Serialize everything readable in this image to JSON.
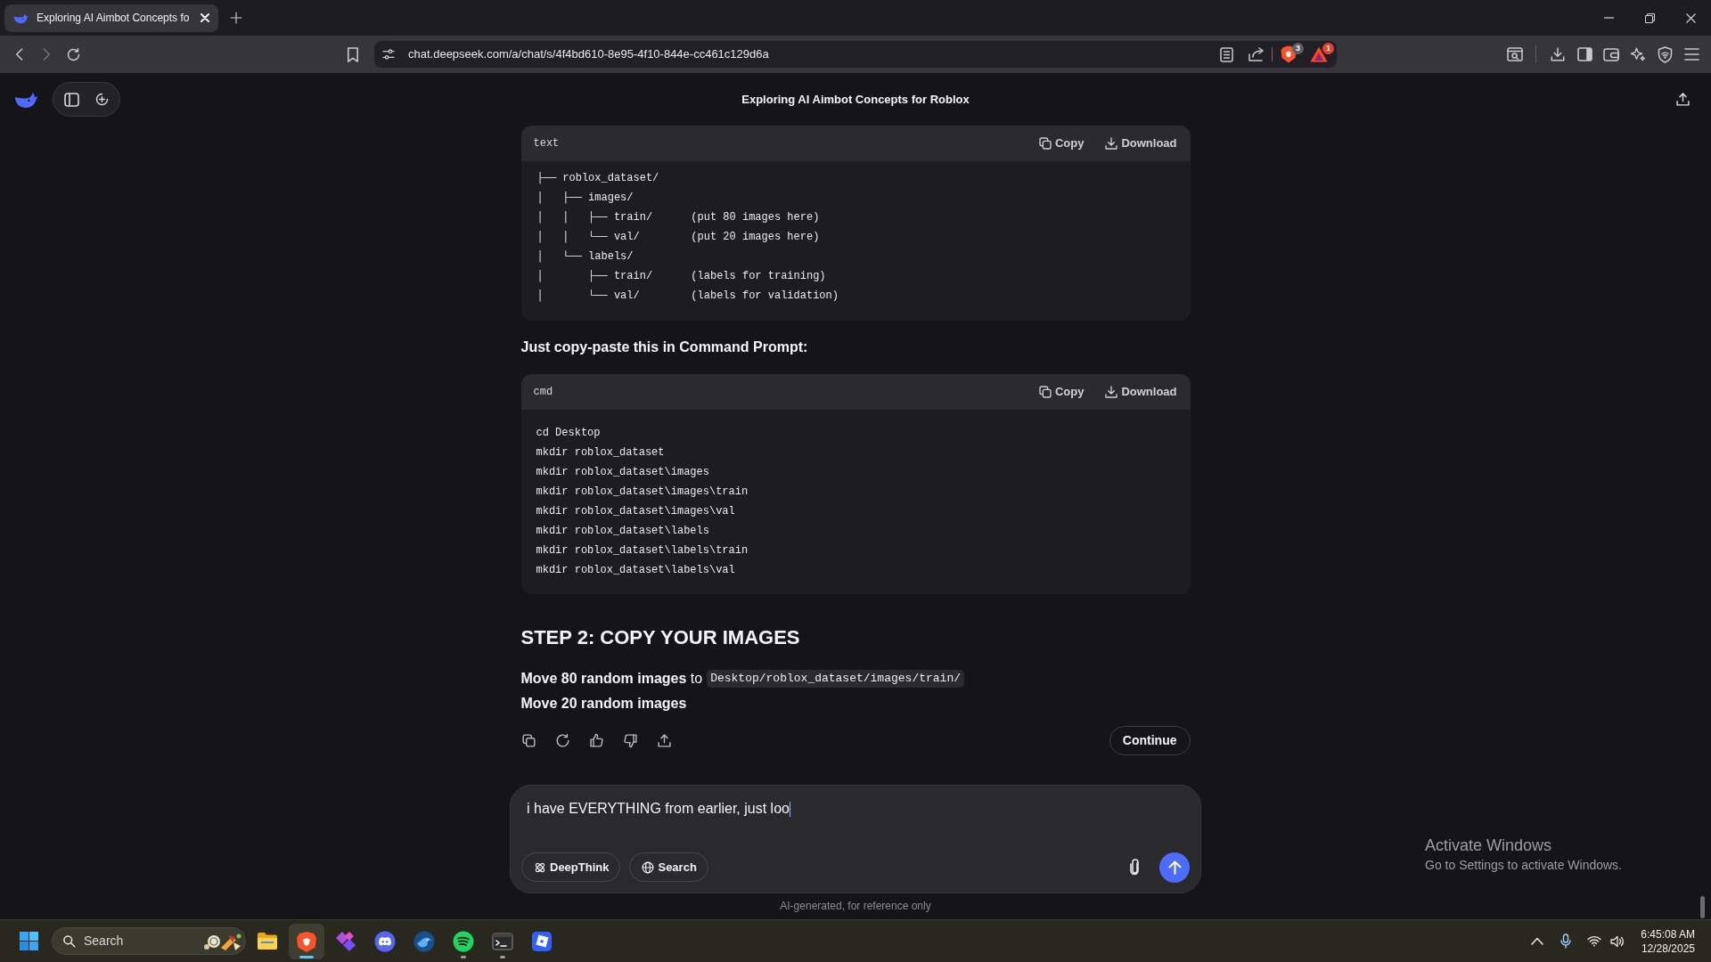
{
  "browser": {
    "tabs": [
      {
        "title": "Exploring AI Aimbot Concepts fo",
        "selected": true
      }
    ],
    "address": "chat.deepseek.com/a/chat/s/4f4bd610-8e95-4f10-844e-cc461c129d6a",
    "shields_badge": "3",
    "rewards_badge": "1"
  },
  "chat": {
    "title": "Exploring AI Aimbot Concepts for Roblox",
    "blocks": [
      {
        "kind": "code",
        "language": "text",
        "copy_label": "Copy",
        "download_label": "Download",
        "lines": [
          "├── roblox_dataset/",
          "│   ├── images/",
          "│   │   ├── train/      (put 80 images here)",
          "│   │   └── val/        (put 20 images here)",
          "│   └── labels/",
          "│       ├── train/      (labels for training)",
          "│       └── val/        (labels for validation)"
        ]
      },
      {
        "kind": "label",
        "text": "Just copy-paste this in Command Prompt:"
      },
      {
        "kind": "code",
        "language": "cmd",
        "copy_label": "Copy",
        "download_label": "Download",
        "lines": [
          "cd Desktop",
          "mkdir roblox_dataset",
          "mkdir roblox_dataset\\images",
          "mkdir roblox_dataset\\images\\train",
          "mkdir roblox_dataset\\images\\val",
          "mkdir roblox_dataset\\labels",
          "mkdir roblox_dataset\\labels\\train",
          "mkdir roblox_dataset\\labels\\val"
        ]
      },
      {
        "kind": "heading",
        "text": "STEP 2: COPY YOUR IMAGES"
      },
      {
        "kind": "paragraph",
        "text": "**Move 80 random images** to",
        "code": "Desktop/roblox_dataset/images/train/"
      },
      {
        "kind": "label",
        "text": "Move 20 random images"
      }
    ],
    "continue_label": "Continue"
  },
  "composer": {
    "value": "i have EVERYTHING from earlier, just loo",
    "toggles": [
      {
        "label": "DeepThink",
        "on": false
      },
      {
        "label": "Search",
        "on": false
      }
    ],
    "note": "AI-generated, for reference only"
  },
  "activation_notice": {
    "title": "Activate Windows",
    "message": "Go to Settings to activate Windows."
  },
  "taskbar": {
    "search_placeholder": "Search",
    "apps": [
      {
        "kind": "folder",
        "running": false,
        "selected": false
      },
      {
        "kind": "browser",
        "running": true,
        "selected": true
      },
      {
        "kind": "tiles",
        "running": false,
        "selected": false
      },
      {
        "kind": "chat",
        "running": false,
        "selected": false
      },
      {
        "kind": "bird",
        "running": false,
        "selected": false
      },
      {
        "kind": "music",
        "running": true,
        "selected": false
      },
      {
        "kind": "terminal",
        "running": true,
        "selected": false
      },
      {
        "kind": "studio",
        "running": false,
        "selected": false
      }
    ],
    "time": "6:45:08 AM",
    "date": "12/28/2025"
  }
}
